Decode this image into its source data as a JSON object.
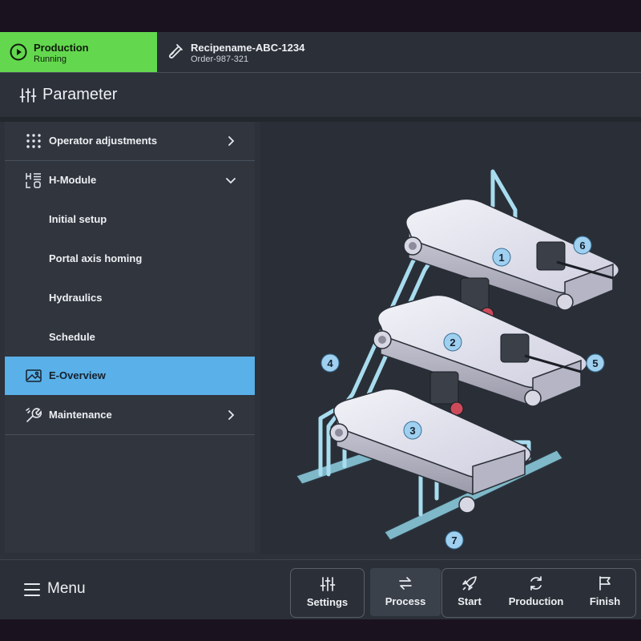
{
  "status": {
    "production_title": "Production",
    "production_state": "Running",
    "recipe_name": "Recipename-ABC-1234",
    "order": "Order-987-321",
    "accent_green": "#63d84e"
  },
  "header": {
    "title": "Parameter",
    "icon": "sliders-icon"
  },
  "sidebar": {
    "items": [
      {
        "label": "Operator adjustments",
        "icon": "grid-dots-icon",
        "chevron": "chevron-right-icon"
      },
      {
        "label": "H-Module",
        "icon": "h-module-icon",
        "chevron": "chevron-down-icon",
        "expanded": true
      },
      {
        "label": "Initial setup"
      },
      {
        "label": "Portal axis homing"
      },
      {
        "label": "Hydraulics"
      },
      {
        "label": "Schedule"
      },
      {
        "label": "E-Overview",
        "icon": "image-icon",
        "active": true
      },
      {
        "label": "Maintenance",
        "icon": "wrench-icon",
        "chevron": "chevron-right-icon"
      }
    ],
    "active_color": "#5ab0e8"
  },
  "diagram": {
    "callouts": [
      "1",
      "2",
      "3",
      "4",
      "5",
      "6",
      "7"
    ]
  },
  "bottombar": {
    "menu_label": "Menu",
    "buttons": [
      {
        "label": "Settings",
        "icon": "sliders-icon"
      },
      {
        "label": "Process",
        "icon": "swap-arrows-icon"
      },
      {
        "label": "Start",
        "icon": "rocket-icon"
      },
      {
        "label": "Production",
        "icon": "refresh-icon"
      },
      {
        "label": "Finish",
        "icon": "flag-icon"
      }
    ]
  }
}
